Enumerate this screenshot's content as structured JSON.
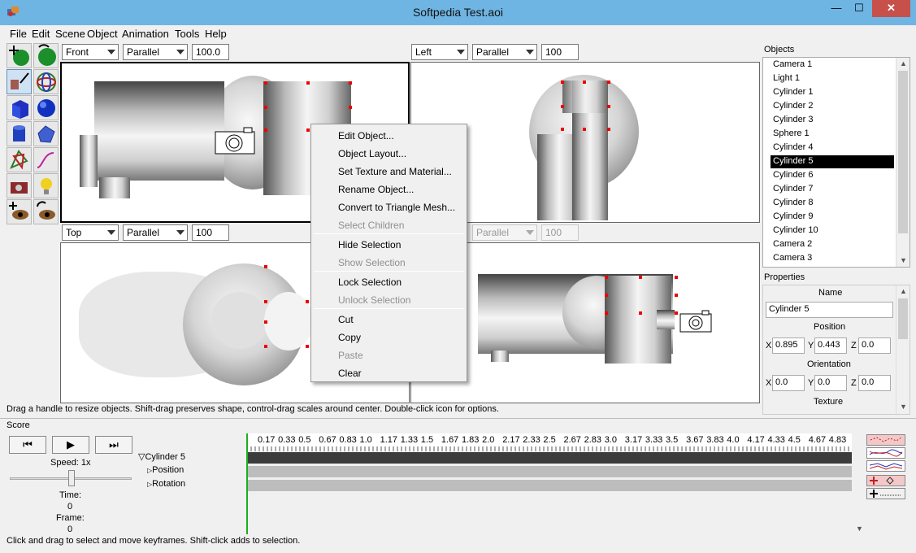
{
  "window": {
    "title": "Softpedia Test.aoi",
    "minimize": "—",
    "maximize": "☐",
    "close": "✕"
  },
  "menu": [
    "File",
    "Edit",
    "Scene",
    "Object",
    "Animation",
    "Tools",
    "Help"
  ],
  "viewports": {
    "v1": {
      "view": "Front",
      "projection": "Parallel",
      "zoom": "100.0"
    },
    "v2": {
      "view": "Left",
      "projection": "Parallel",
      "zoom": "100"
    },
    "v3": {
      "view": "Top",
      "projection": "Parallel",
      "zoom": "100"
    },
    "v4": {
      "projection": "Parallel",
      "zoom": "100"
    }
  },
  "context_menu": {
    "edit_object": "Edit Object...",
    "object_layout": "Object Layout...",
    "set_texture": "Set Texture and Material...",
    "rename": "Rename Object...",
    "convert": "Convert to Triangle Mesh...",
    "select_children": "Select Children",
    "hide": "Hide Selection",
    "show": "Show Selection",
    "lock": "Lock Selection",
    "unlock": "Unlock Selection",
    "cut": "Cut",
    "copy": "Copy",
    "paste": "Paste",
    "clear": "Clear"
  },
  "status_top": "Drag a handle to resize objects.  Shift-drag preserves shape, control-drag scales around center.  Double-click icon for options.",
  "objects": {
    "header": "Objects",
    "items": [
      "Camera 1",
      "Light 1",
      "Cylinder 1",
      "Cylinder 2",
      "Cylinder 3",
      "Sphere 1",
      "Cylinder 4",
      "Cylinder 5",
      "Cylinder 6",
      "Cylinder 7",
      "Cylinder 8",
      "Cylinder 9",
      "Cylinder 10",
      "Camera 2",
      "Camera 3"
    ],
    "selected": "Cylinder 5"
  },
  "properties": {
    "header": "Properties",
    "name_label": "Name",
    "name_value": "Cylinder 5",
    "position_label": "Position",
    "pos_x": "0.895",
    "pos_y": "0.443",
    "pos_z": "0.0",
    "orientation_label": "Orientation",
    "ori_x": "0.0",
    "ori_y": "0.0",
    "ori_z": "0.0",
    "texture_label": "Texture",
    "x": "X",
    "y": "Y",
    "z": "Z"
  },
  "score": {
    "header": "Score",
    "speed": "Speed: 1x",
    "time_label": "Time:",
    "time_value": "0",
    "frame_label": "Frame:",
    "frame_value": "0",
    "tree": {
      "root": "Cylinder 5",
      "children": [
        "Position",
        "Rotation"
      ]
    },
    "ticks": [
      "0.17",
      "0.33",
      "0.5",
      "0.67",
      "0.83",
      "1.0",
      "1.17",
      "1.33",
      "1.5",
      "1.67",
      "1.83",
      "2.0",
      "2.17",
      "2.33",
      "2.5",
      "2.67",
      "2.83",
      "3.0",
      "3.17",
      "3.33",
      "3.5",
      "3.67",
      "3.83",
      "4.0",
      "4.17",
      "4.33",
      "4.5",
      "4.67",
      "4.83"
    ]
  },
  "status_bottom": "Click and drag to select and move keyframes.  Shift-click adds to selection.",
  "colors": {
    "titlebar": "#6fb5e3",
    "close": "#c7504b",
    "selection": "#000000",
    "handle": "#ee0000"
  }
}
